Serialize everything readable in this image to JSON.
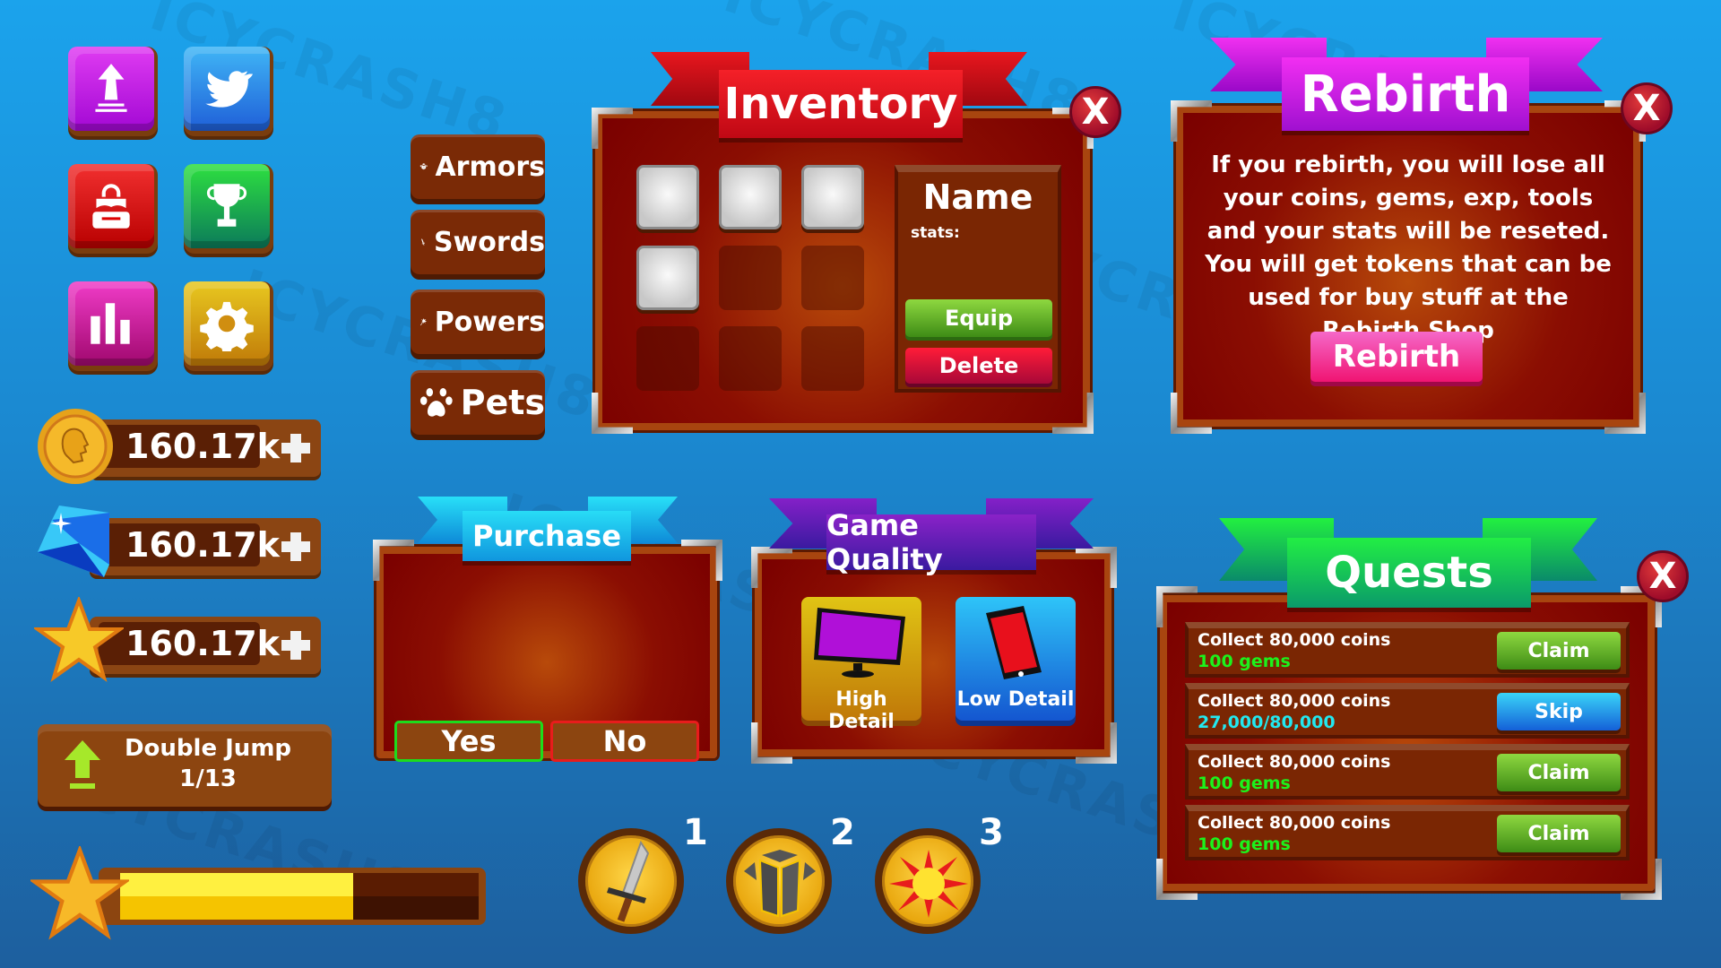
{
  "watermark": "ICYCRASH8",
  "menu_buttons": [
    {
      "name": "rebirth-button",
      "icon": "rebirth-arrow-icon",
      "color": "#c010e0"
    },
    {
      "name": "twitter-button",
      "icon": "twitter-bird-icon",
      "color": "#2f86ea"
    },
    {
      "name": "backpack-button",
      "icon": "backpack-icon",
      "color": "#dd0f0f"
    },
    {
      "name": "leaderboard-trophy-button",
      "icon": "trophy-icon",
      "color": "#12b248"
    },
    {
      "name": "stats-button",
      "icon": "bar-chart-icon",
      "color": "#d0149e"
    },
    {
      "name": "settings-button",
      "icon": "gear-icon",
      "color": "#d69a0c"
    }
  ],
  "currencies": [
    {
      "type": "coins",
      "icon": "coin-icon",
      "value": "160.17k"
    },
    {
      "type": "gems",
      "icon": "gem-icon",
      "value": "160.17k"
    },
    {
      "type": "stars",
      "icon": "star-icon",
      "value": "160.17k"
    }
  ],
  "double_jump": {
    "label": "Double Jump",
    "progress": "1/13",
    "icon": "up-arrow-icon"
  },
  "xp_bar": {
    "fill_percent": 65,
    "icon": "star-icon"
  },
  "category_tabs": [
    {
      "label": "Armors",
      "icon": "armor-icon"
    },
    {
      "label": "Swords",
      "icon": "sword-icon"
    },
    {
      "label": "Powers",
      "icon": "magic-wand-icon"
    },
    {
      "label": "Pets",
      "icon": "paw-icon"
    }
  ],
  "inventory": {
    "title": "Inventory",
    "close": "X",
    "slots": [
      "filled",
      "filled",
      "filled",
      "filled",
      "empty",
      "empty",
      "empty",
      "empty",
      "empty"
    ],
    "details": {
      "name": "Name",
      "stats_label": "stats:"
    },
    "equip_label": "Equip",
    "delete_label": "Delete",
    "ribbon_color": "#e0141c"
  },
  "rebirth": {
    "title": "Rebirth",
    "close": "X",
    "message": "If you rebirth, you will lose all your coins, gems, exp, tools and your stats will be reseted. You will get tokens that can be used for buy stuff at the Rebirth Shop",
    "button_label": "Rebirth",
    "ribbon_color": "#c21ae0"
  },
  "purchase": {
    "title": "Purchase",
    "yes_label": "Yes",
    "no_label": "No",
    "ribbon_color": "#1cb8ea"
  },
  "game_quality": {
    "title": "Game Quality",
    "options": [
      {
        "label": "High Detail",
        "icon": "monitor-icon"
      },
      {
        "label": "Low Detail",
        "icon": "phone-icon"
      }
    ],
    "ribbon_color": "#5a1fb0"
  },
  "quests": {
    "title": "Quests",
    "close": "X",
    "items": [
      {
        "task": "Collect 80,000 coins",
        "reward": "100 gems",
        "reward_color": "#1cf21c",
        "button": "Claim",
        "button_type": "claim"
      },
      {
        "task": "Collect 80,000 coins",
        "reward": "27,000/80,000",
        "reward_color": "#22e8f0",
        "button": "Skip",
        "button_type": "skip"
      },
      {
        "task": "Collect 80,000 coins",
        "reward": "100 gems",
        "reward_color": "#1cf21c",
        "button": "Claim",
        "button_type": "claim"
      },
      {
        "task": "Collect 80,000 coins",
        "reward": "100 gems",
        "reward_color": "#1cf21c",
        "button": "Claim",
        "button_type": "claim"
      }
    ],
    "ribbon_color": "#12b85a"
  },
  "hotbar": [
    {
      "slot": "1",
      "icon": "sword-icon"
    },
    {
      "slot": "2",
      "icon": "armor-icon"
    },
    {
      "slot": "3",
      "icon": "explosion-icon"
    }
  ]
}
